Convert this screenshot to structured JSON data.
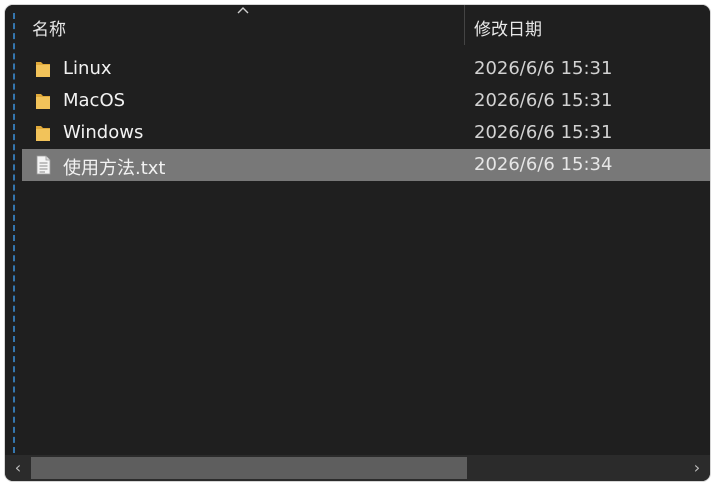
{
  "header": {
    "name_col": "名称",
    "date_col": "修改日期"
  },
  "files": [
    {
      "name": "Linux",
      "modified": "2026/6/6 15:31",
      "type": "folder",
      "icon": "folder-icon"
    },
    {
      "name": "MacOS",
      "modified": "2026/6/6 15:31",
      "type": "folder",
      "icon": "folder-icon"
    },
    {
      "name": "Windows",
      "modified": "2026/6/6 15:31",
      "type": "folder",
      "icon": "folder-icon"
    },
    {
      "name": "使用方法.txt",
      "modified": "2026/6/6 15:34",
      "type": "text-file",
      "icon": "text-file-icon",
      "selected": true
    }
  ],
  "scrollbar": {
    "left_glyph": "‹",
    "right_glyph": "›"
  },
  "colors": {
    "background": "#1f1f1f",
    "selection": "#787878",
    "folder": "#f2c35a",
    "accent_dash": "#3a86c8"
  }
}
